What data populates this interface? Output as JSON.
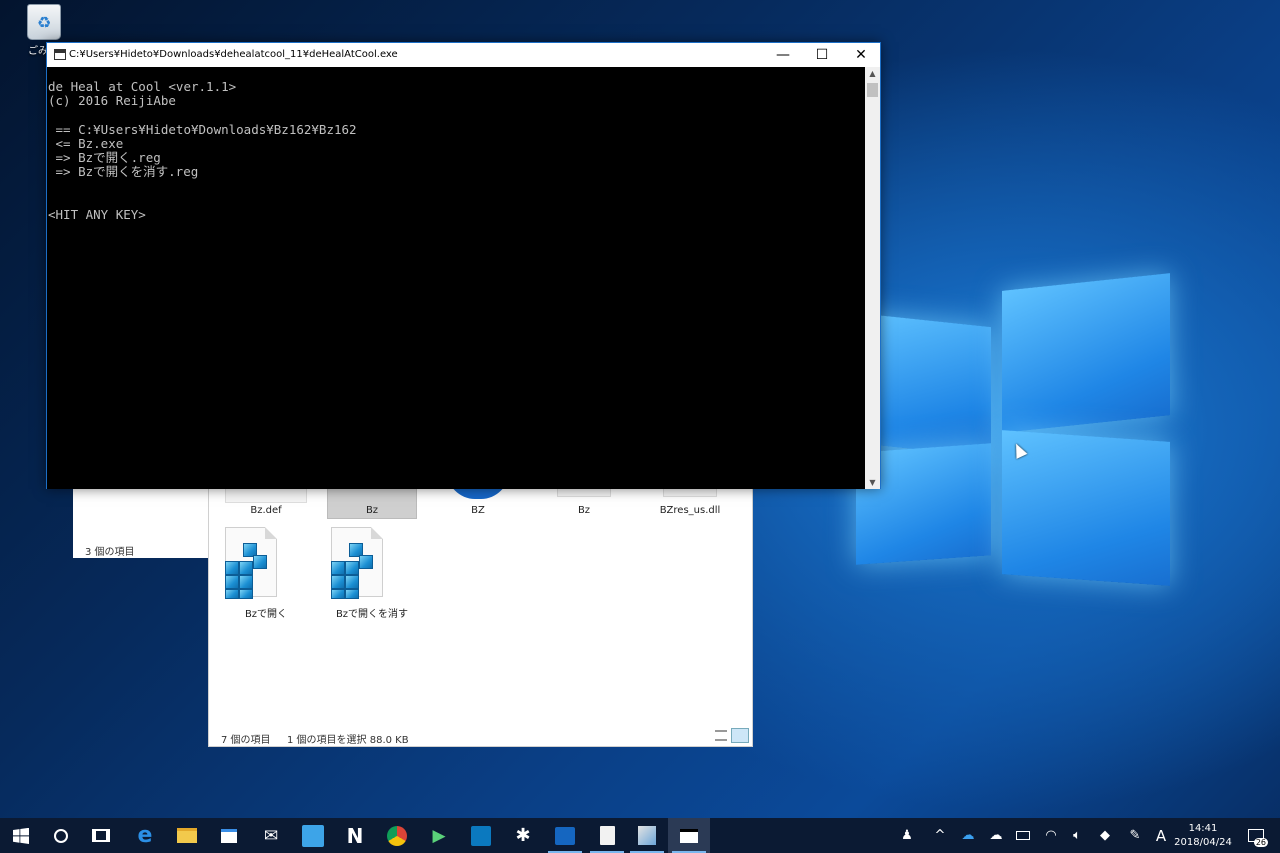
{
  "desktop": {
    "recycle_bin_label": "ごみ"
  },
  "console": {
    "title": "C:¥Users¥Hideto¥Downloads¥dehealatcool_11¥deHealAtCool.exe",
    "lines": [
      "de Heal at Cool <ver.1.1>",
      "(c) 2016 ReijiAbe",
      "",
      " == C:¥Users¥Hideto¥Downloads¥Bz162¥Bz162",
      " <= Bz.exe",
      " => Bzで開く.reg",
      " => Bzで開くを消す.reg",
      "",
      "",
      "<HIT ANY KEY>"
    ]
  },
  "explorer_back": {
    "status": "3 個の項目"
  },
  "explorer": {
    "files": [
      "Bz.def",
      "Bz",
      "BZ",
      "Bz",
      "BZres_us.dll"
    ],
    "reg_files": [
      "Bzで開く",
      "Bzで開くを消す"
    ],
    "status_count": "7 個の項目",
    "status_selection": "1 個の項目を選択  88.0 KB"
  },
  "taskbar": {
    "apps": [
      "start-icon",
      "cortana-icon",
      "task-view-icon",
      "edge-icon",
      "file-explorer-icon",
      "store-icon",
      "mail-icon",
      "app-icon",
      "n-app-icon",
      "chrome-icon",
      "pen-app-icon",
      "trello-icon",
      "slack-icon",
      "powershell-icon",
      "notepad-icon",
      "paint-icon",
      "console-app-icon"
    ],
    "ime": "A",
    "time": "14:41",
    "date": "2018/04/24",
    "notifications": "26"
  }
}
